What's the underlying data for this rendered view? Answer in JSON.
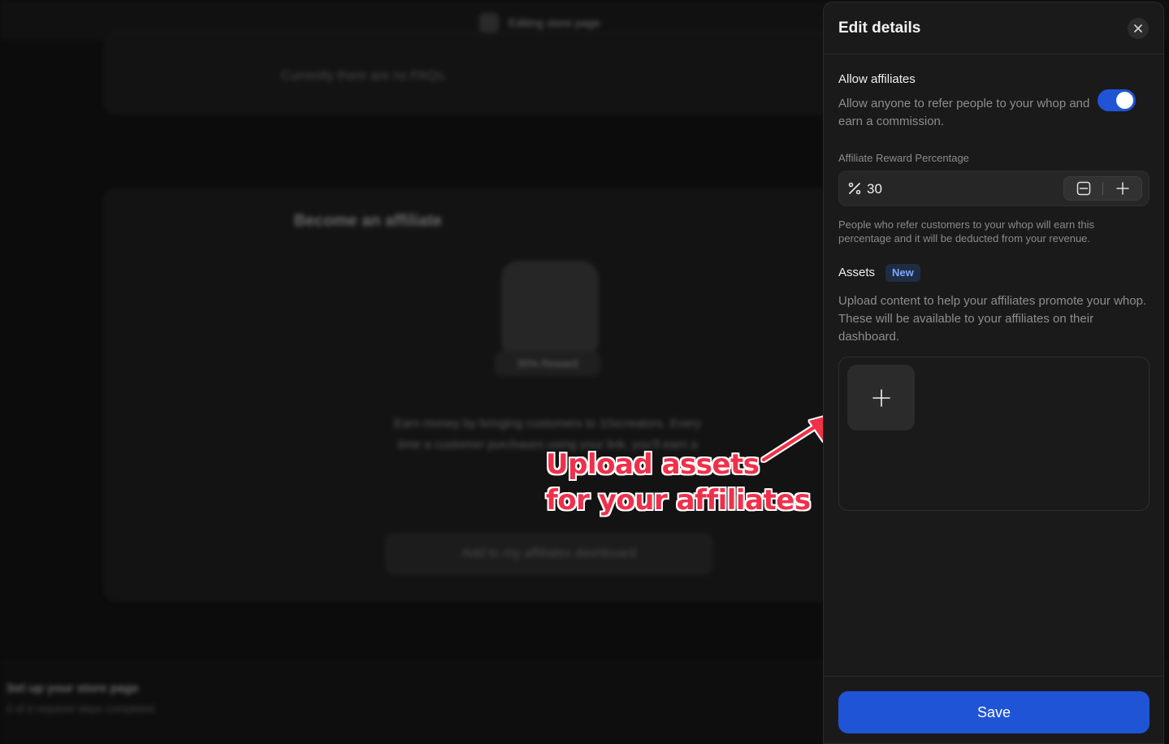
{
  "background": {
    "topbar_title": "Editing store page",
    "faq_empty_text": "Currently there are no FAQs.",
    "affiliate_card": {
      "heading": "Become an affiliate",
      "reward_badge": "30% Reward",
      "description": "Earn money by bringing customers to 10xcreators. Every time a customer purchases using your link, you'll earn a",
      "button_label": "Add to my affiliates dashboard"
    },
    "footer": {
      "title": "Set up your store page",
      "subtitle": "0 of 4 required steps completed"
    }
  },
  "panel": {
    "title": "Edit details",
    "allow_affiliates": {
      "label": "Allow affiliates",
      "description": "Allow anyone to refer people to your whop and earn a commission.",
      "enabled": true
    },
    "reward": {
      "label": "Affiliate Reward Percentage",
      "value": "30",
      "helper": "People who refer customers to your whop will earn this percentage and it will be deducted from your revenue."
    },
    "assets": {
      "label": "Assets",
      "badge": "New",
      "description": "Upload content to help your affiliates promote your whop. These will be available to your affiliates on their dashboard."
    },
    "save_label": "Save"
  },
  "annotation": {
    "line1": "Upload assets",
    "line2": "for your affiliates",
    "color": "#f0304a"
  },
  "colors": {
    "accent": "#1f54d6",
    "panel_bg": "#1a1a1a"
  }
}
